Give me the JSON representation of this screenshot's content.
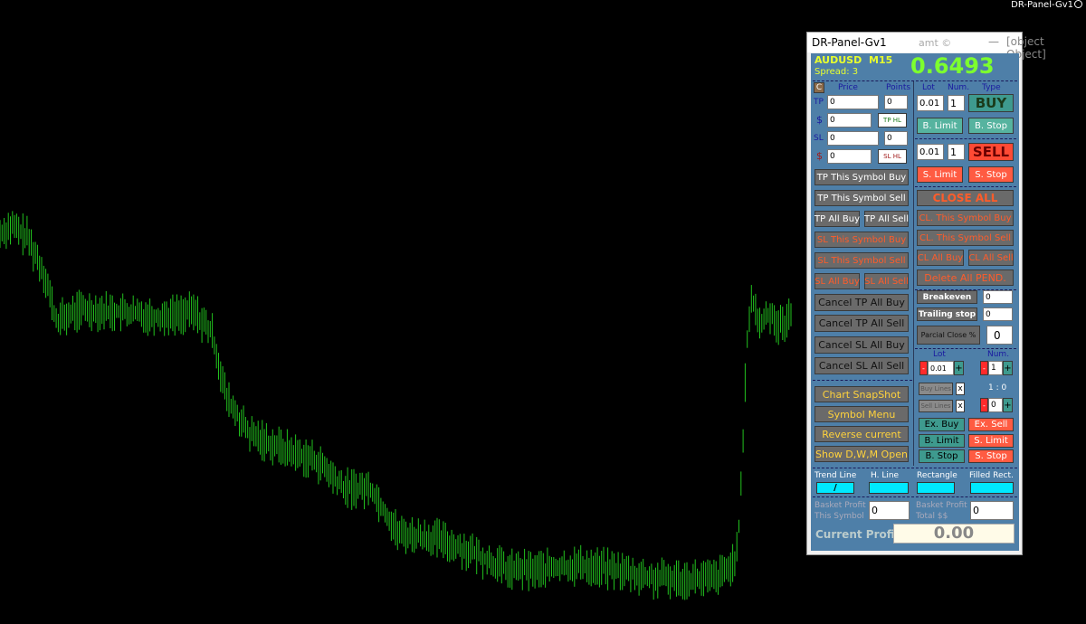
{
  "ea_label": "DR-Panel-Gv1",
  "chart": {
    "line_color": "#22c21e"
  },
  "panel": {
    "title": "DR-Panel-Gv1",
    "brand": "amt ©",
    "minimize": "—",
    "close": {
      "close_all": "CLOSE  ALL",
      "cl_this_symbol_buy": "CL. This Symbol Buy",
      "cl_this_symbol_sell": "CL. This Symbol Sell",
      "cl_all_buy": "CL All Buy",
      "cl_all_sell": "CL All Sell",
      "delete_all_pend": "Delete All PEND."
    },
    "symbol": "AUDUSD",
    "timeframe": "M15",
    "spread": "Spread: 3",
    "price": "0.6493",
    "tp_sl": {
      "c_label": "C",
      "price_label": "Price",
      "points_label": "Points",
      "tp_label": "TP",
      "tp_price": "0",
      "tp_points": "0",
      "tp_money_label": "$",
      "tp_money": "0",
      "tp_hl": "TP HL",
      "sl_label": "SL",
      "sl_price": "0",
      "sl_points": "0",
      "sl_money_label": "$",
      "sl_money": "0",
      "sl_hl": "SL HL"
    },
    "left_buttons": {
      "tp_this_symbol_buy": "TP This Symbol Buy",
      "tp_this_symbol_sell": "TP This Symbol Sell",
      "tp_all_buy": "TP All Buy",
      "tp_all_sell": "TP All Sell",
      "sl_this_symbol_buy": "SL This Symbol Buy",
      "sl_this_symbol_sell": "SL This Symbol Sell",
      "sl_all_buy": "SL All Buy",
      "sl_all_sell": "SL All Sell",
      "cancel_tp_all_buy": "Cancel  TP  All Buy",
      "cancel_tp_all_sell": "Cancel  TP  All Sell",
      "cancel_sl_all_buy": "Cancel  SL  All Buy",
      "cancel_sl_all_sell": "Cancel  SL  All Sell",
      "chart_snapshot": "Chart SnapShot",
      "symbol_menu": "Symbol Menu",
      "reverse_current": "Reverse current",
      "show_dwm_open": "Show D,W,M Open"
    },
    "order": {
      "lot_label": "Lot",
      "num_label": "Num.",
      "type_label": "Type",
      "buy_lot": "0.01",
      "buy_num": "1",
      "buy": "BUY",
      "b_limit": "B. Limit",
      "b_stop": "B. Stop",
      "sell_lot": "0.01",
      "sell_num": "1",
      "sell": "SELL",
      "s_limit": "S. Limit",
      "s_stop": "S. Stop"
    },
    "manage": {
      "breakeven": "Breakeven",
      "breakeven_val": "0",
      "trailing_stop": "Trailing stop",
      "trailing_val": "0",
      "partial_close": "Parcial Close %",
      "partial_val": "0"
    },
    "grid": {
      "lot_label": "Lot",
      "num_label": "Num.",
      "lot_val": "0.01",
      "num_val": "1",
      "minus": "-",
      "plus": "+",
      "buy_lines": "Buy  Lines",
      "sell_lines": "Sell  Lines",
      "x": "x",
      "ratio": "1 : 0",
      "ratio_val": "0",
      "ex_buy": "Ex. Buy",
      "ex_sell": "Ex. Sell",
      "b_limit": "B. Limit",
      "s_limit": "S. Limit",
      "b_stop": "B. Stop",
      "s_stop": "S. Stop"
    },
    "drawing": {
      "trend_line": "Trend Line",
      "trend_icon": "/",
      "h_line": "H. Line",
      "rectangle": "Rectangle",
      "filled_rect": "Filled Rect."
    },
    "profit": {
      "basket_this_1": "Basket Profit",
      "basket_this_2": "This Symbol",
      "basket_this_val": "0",
      "basket_total_1": "Basket Profit",
      "basket_total_2": "Total $$",
      "basket_total_val": "0",
      "current_profit": "Current Profit",
      "current_profit_val": "0.00"
    }
  }
}
